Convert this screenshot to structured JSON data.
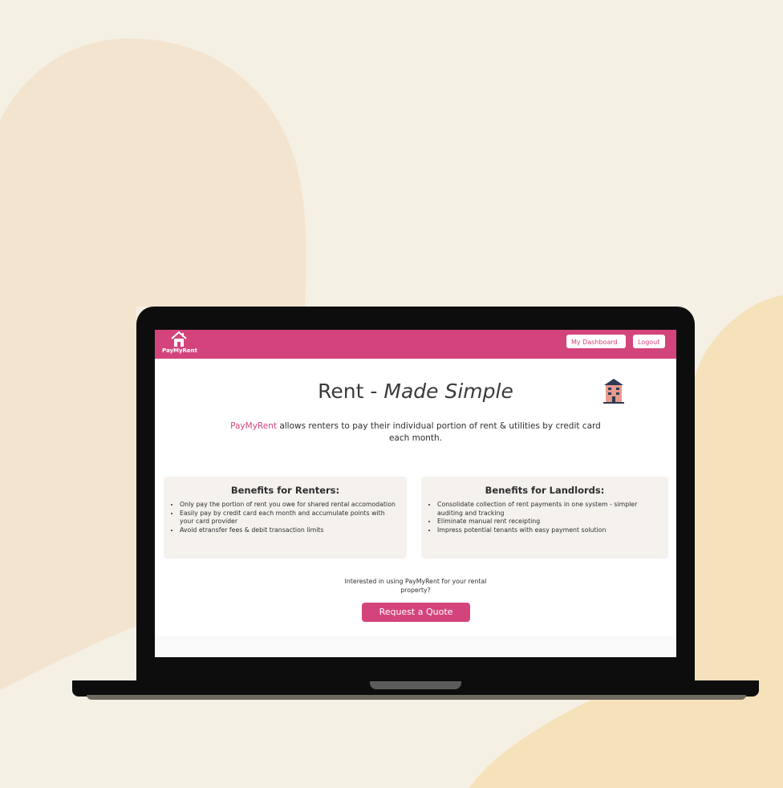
{
  "colors": {
    "accent": "#d4447c",
    "background": "#f5f0e4",
    "card": "#f5f2ee"
  },
  "nav": {
    "brand": "PayMyRent",
    "logo_icon": "house-icon",
    "dashboard_label": "My Dashboard",
    "logout_label": "Logout"
  },
  "hero": {
    "title_main": "Rent - ",
    "title_italic": "Made Simple",
    "building_icon": "apartment-building-icon",
    "desc_brand": "PayMyRent",
    "desc_rest": " allows renters to pay their individual portion of rent & utilities by credit card each month."
  },
  "renters": {
    "title": "Benefits for Renters:",
    "items": [
      "Only pay the portion of rent you owe for shared rental accomodation",
      "Easily pay by credit card each month and accumulate points with your card provider",
      "Avoid etransfer fees & debit transaction limits"
    ]
  },
  "landlords": {
    "title": "Benefits for Landlords:",
    "items": [
      "Consolidate collection of rent payments in one system - simpler auditing and tracking",
      "Eliminate manual rent receipting",
      "Impress potential tenants with easy payment solution"
    ]
  },
  "cta": {
    "question": "Interested in using PayMyRent for your rental property?",
    "button": "Request a Quote"
  }
}
